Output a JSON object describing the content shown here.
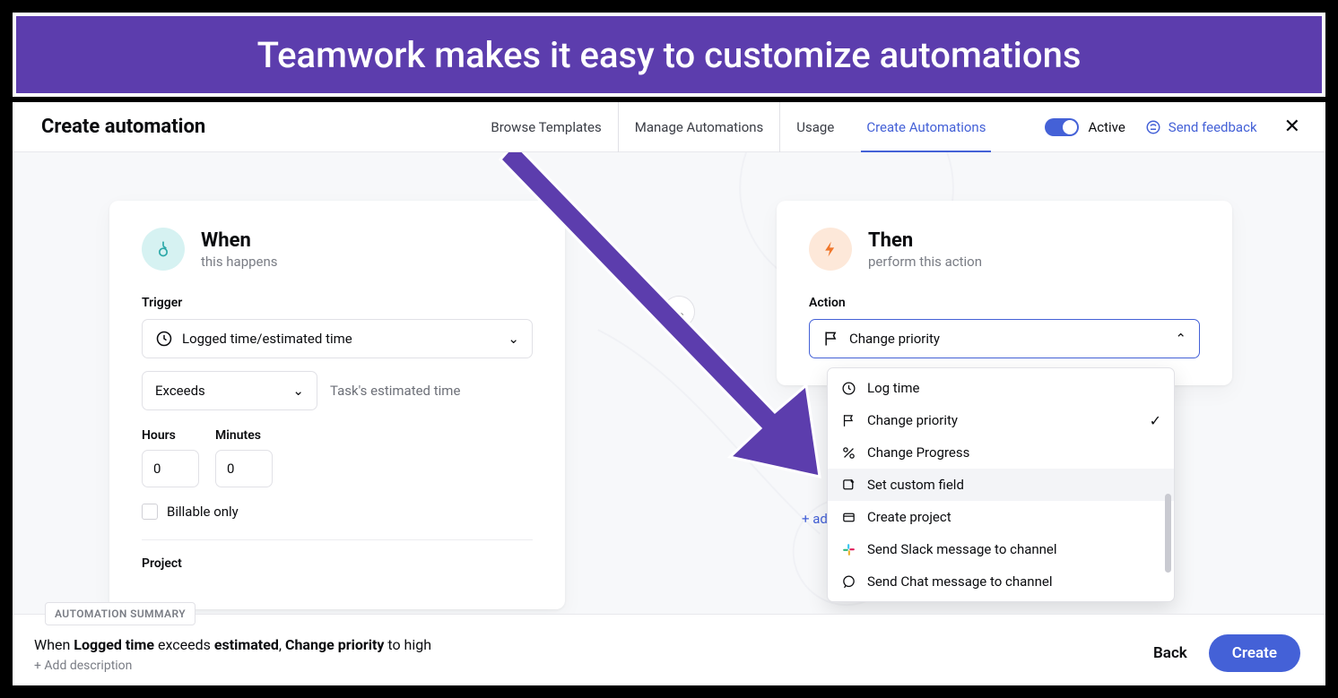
{
  "banner": {
    "text": "Teamwork makes it easy to customize automations"
  },
  "header": {
    "title": "Create automation",
    "tabs": [
      "Browse Templates",
      "Manage Automations",
      "Usage",
      "Create Automations"
    ],
    "active_tab": 3,
    "toggle_label": "Active",
    "feedback": "Send feedback"
  },
  "when": {
    "title": "When",
    "subtitle": "this happens",
    "trigger_label": "Trigger",
    "trigger_value": "Logged time/estimated time",
    "condition_value": "Exceeds",
    "condition_hint": "Task's estimated time",
    "hours_label": "Hours",
    "hours_value": "0",
    "minutes_label": "Minutes",
    "minutes_value": "0",
    "billable_label": "Billable only",
    "project_label": "Project"
  },
  "then": {
    "title": "Then",
    "subtitle": "perform this action",
    "action_label": "Action",
    "action_value": "Change priority",
    "options": [
      {
        "icon": "clock",
        "label": "Log time"
      },
      {
        "icon": "flag",
        "label": "Change priority",
        "selected": true
      },
      {
        "icon": "percent",
        "label": "Change Progress"
      },
      {
        "icon": "custom",
        "label": "Set custom field",
        "hovered": true
      },
      {
        "icon": "project",
        "label": "Create project"
      },
      {
        "icon": "slack",
        "label": "Send Slack message to channel"
      },
      {
        "icon": "chat",
        "label": "Send Chat message to channel"
      }
    ],
    "add_action": "+ add action"
  },
  "footer": {
    "badge": "AUTOMATION SUMMARY",
    "summary_parts": [
      "When ",
      "Logged time",
      " exceeds ",
      "estimated",
      ", ",
      "Change priority",
      " to high"
    ],
    "add_description": "+ Add description",
    "back": "Back",
    "create": "Create"
  }
}
